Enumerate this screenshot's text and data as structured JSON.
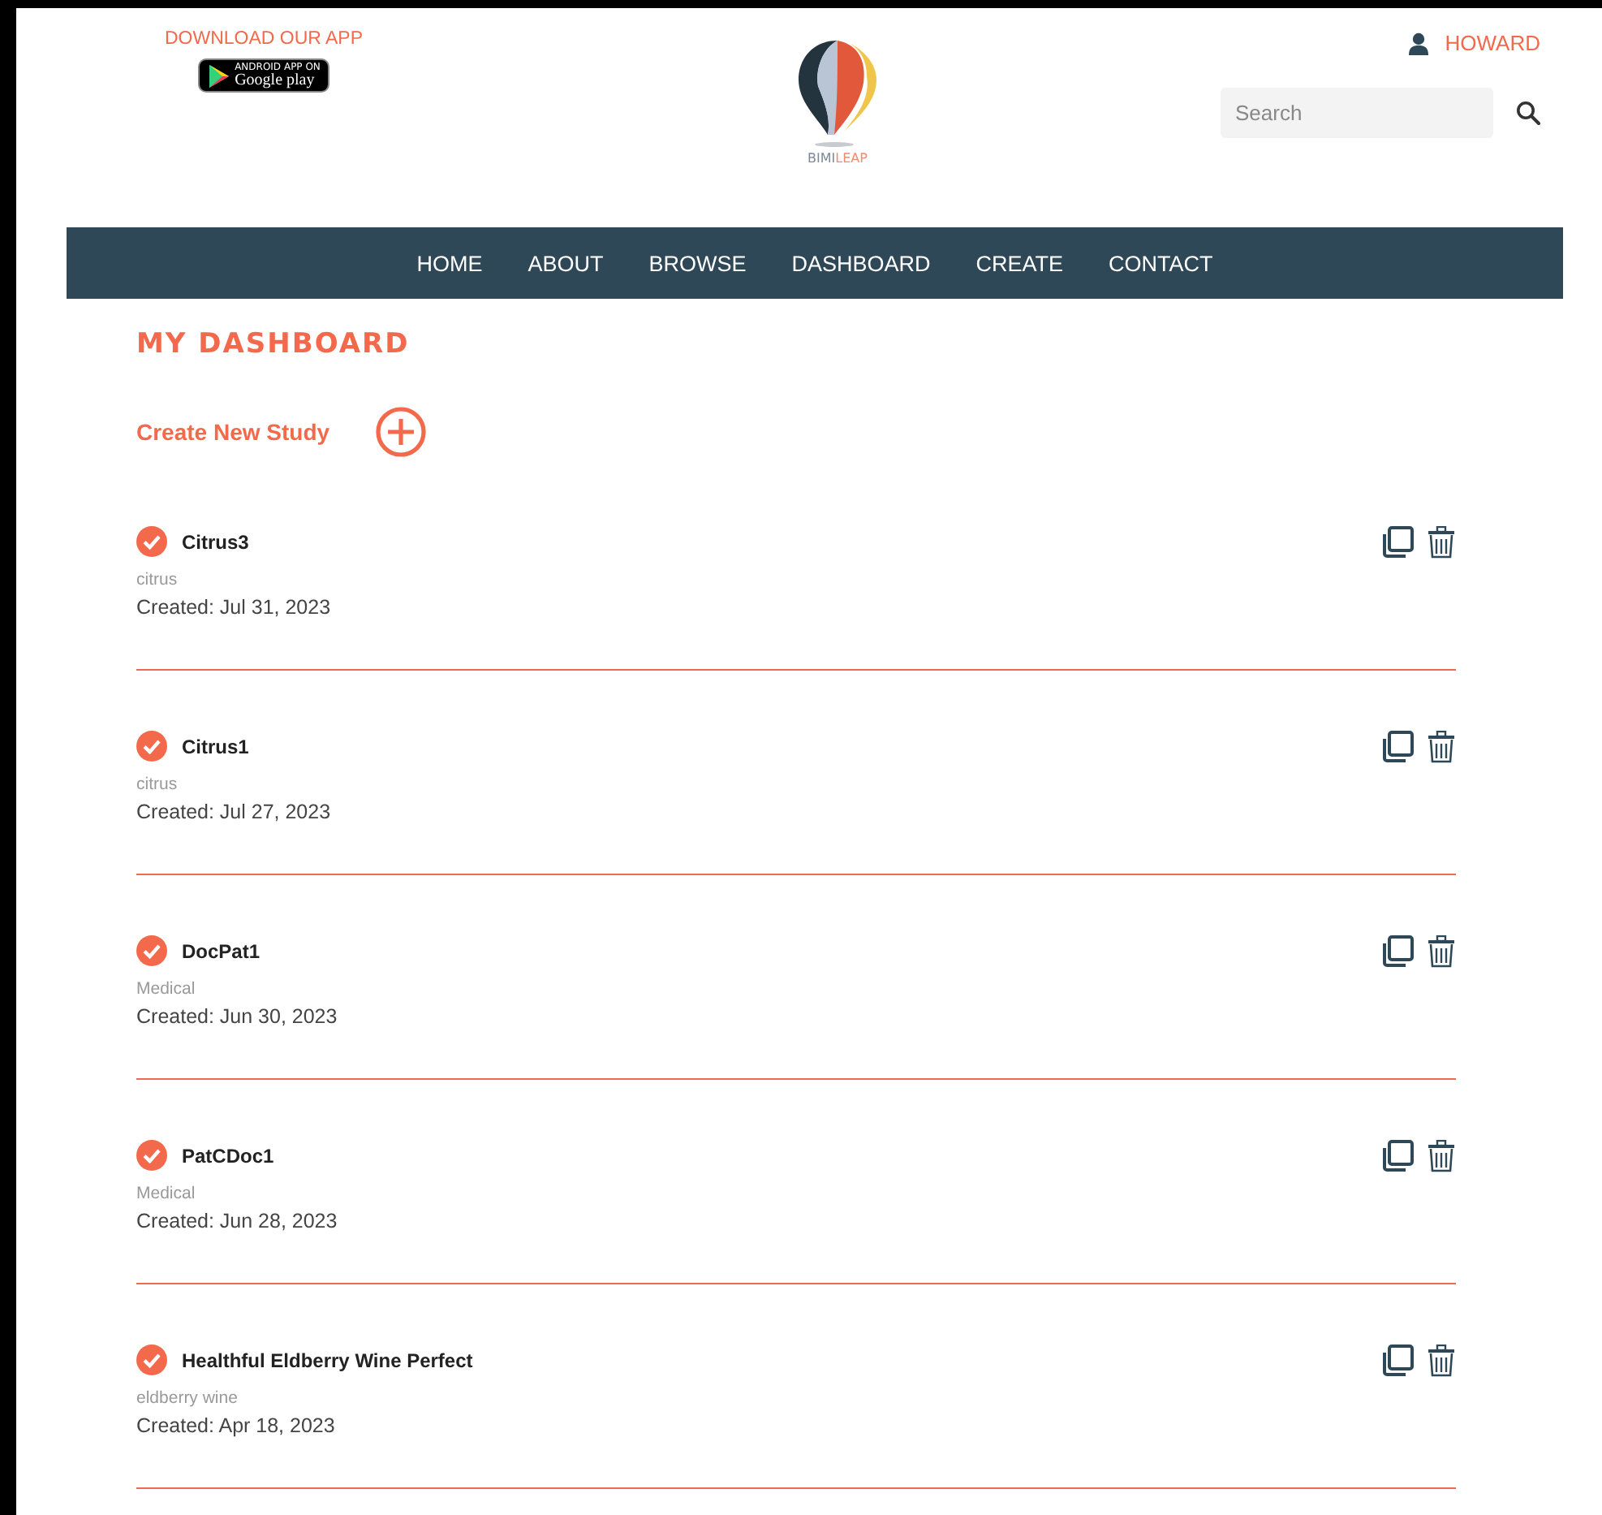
{
  "header": {
    "download_label": "DOWNLOAD OUR APP",
    "store_badge": {
      "small_text": "ANDROID APP ON",
      "text": "Google play"
    },
    "logo": {
      "part_1": "BIMI",
      "part_2": "LEAP"
    },
    "user": "HOWARD",
    "search": {
      "placeholder": "Search"
    }
  },
  "nav": [
    {
      "label": "HOME"
    },
    {
      "label": "ABOUT"
    },
    {
      "label": "BROWSE"
    },
    {
      "label": "DASHBOARD"
    },
    {
      "label": "CREATE"
    },
    {
      "label": "CONTACT"
    }
  ],
  "page_title": "MY DASHBOARD",
  "create_label": "Create New Study",
  "studies": [
    {
      "name": "Citrus3",
      "category": "citrus",
      "created": "Created: Jul 31, 2023",
      "checked": true
    },
    {
      "name": "Citrus1",
      "category": "citrus",
      "created": "Created: Jul 27, 2023",
      "checked": true
    },
    {
      "name": "DocPat1",
      "category": "Medical",
      "created": "Created: Jun 30, 2023",
      "checked": true
    },
    {
      "name": "PatCDoc1",
      "category": "Medical",
      "created": "Created: Jun 28, 2023",
      "checked": true
    },
    {
      "name": "Healthful Eldberry Wine Perfect",
      "category": "eldberry wine",
      "created": "Created: Apr 18, 2023",
      "checked": true
    }
  ]
}
